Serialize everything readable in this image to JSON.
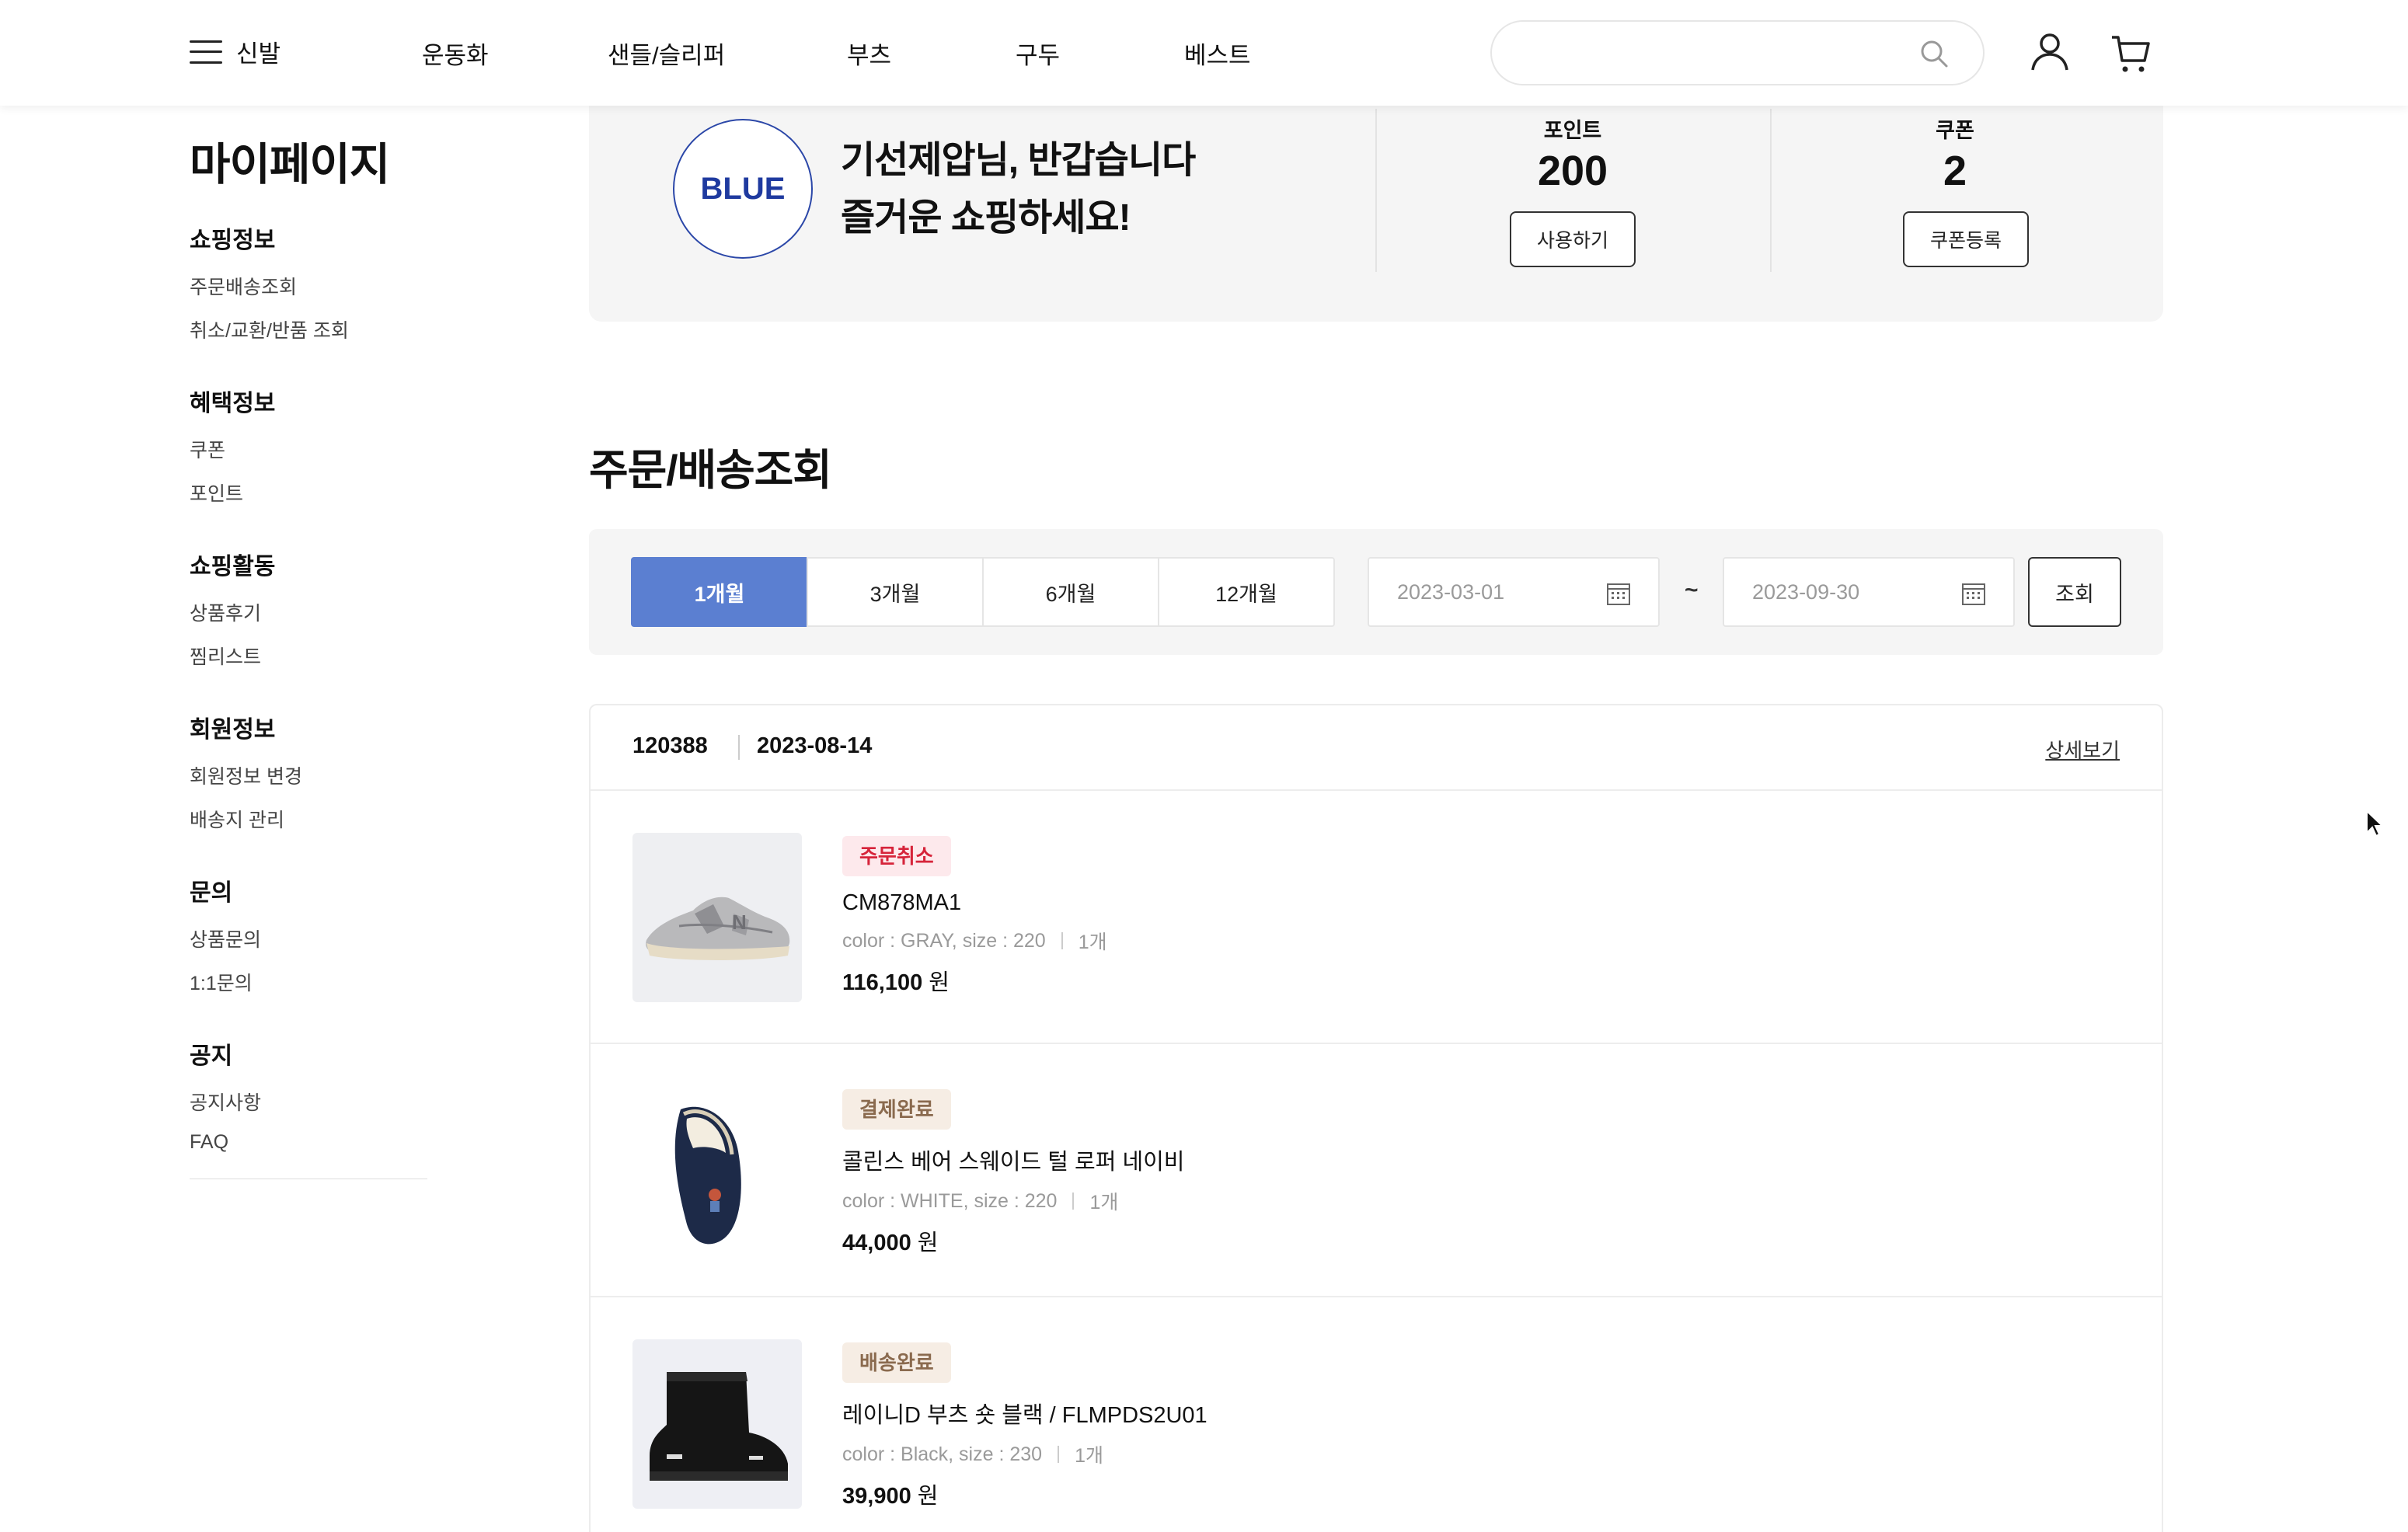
{
  "header": {
    "menu_label": "신발",
    "nav": [
      "운동화",
      "샌들/슬리퍼",
      "부츠",
      "구두",
      "베스트"
    ],
    "search_placeholder": ""
  },
  "sidebar": {
    "title": "마이페이지",
    "groups": [
      {
        "title": "쇼핑정보",
        "items": [
          "주문배송조회",
          "취소/교환/반품 조회"
        ]
      },
      {
        "title": "혜택정보",
        "items": [
          "쿠폰",
          "포인트"
        ]
      },
      {
        "title": "쇼핑활동",
        "items": [
          "상품후기",
          "찜리스트"
        ]
      },
      {
        "title": "회원정보",
        "items": [
          "회원정보 변경",
          "배송지 관리"
        ]
      },
      {
        "title": "문의",
        "items": [
          "상품문의",
          "1:1문의"
        ]
      },
      {
        "title": "공지",
        "items": [
          "공지사항",
          "FAQ"
        ]
      }
    ]
  },
  "profile": {
    "grade": "BLUE",
    "greeting_line1": "기선제압님, 반갑습니다",
    "greeting_line2": "즐거운 쇼핑하세요!",
    "points_label": "포인트",
    "points_value": "200",
    "points_button": "사용하기",
    "coupon_label": "쿠폰",
    "coupon_value": "2",
    "coupon_button": "쿠폰등록"
  },
  "orders_section": {
    "title": "주문/배송조회",
    "periods": [
      "1개월",
      "3개월",
      "6개월",
      "12개월"
    ],
    "active_period": "1개월",
    "date_from": "2023-03-01",
    "date_separator": "~",
    "date_to": "2023-09-30",
    "search_button": "조회"
  },
  "order": {
    "number": "120388",
    "date": "2023-08-14",
    "detail_link": "상세보기",
    "items": [
      {
        "status": "주문취소",
        "status_color": "#d6243a",
        "status_bg": "#fde9ec",
        "name": "CM878MA1",
        "options": "color : GRAY, size : 220",
        "qty": "1개",
        "price": "116,100",
        "currency": "원",
        "image": "grey-sneaker"
      },
      {
        "status": "결제완료",
        "status_color": "#8a6a4e",
        "status_bg": "#f6ede4",
        "name": "콜린스 베어 스웨이드 털 로퍼 네이비",
        "options": "color : WHITE, size : 220",
        "qty": "1개",
        "price": "44,000",
        "currency": "원",
        "image": "navy-loafer"
      },
      {
        "status": "배송완료",
        "status_color": "#8a6a4e",
        "status_bg": "#f6ede4",
        "name": "레이니D 부츠 숏 블랙 / FLMPDS2U01",
        "options": "color : Black, size : 230",
        "qty": "1개",
        "price": "39,900",
        "currency": "원",
        "image": "black-rain-boot"
      }
    ]
  },
  "icons": {
    "search": "search-icon",
    "user": "user-icon",
    "cart": "cart-icon",
    "calendar": "calendar-icon",
    "menu": "hamburger-icon"
  },
  "colors": {
    "accent": "#5b7fd1",
    "grade_blue": "#1f3a9f",
    "panel_bg": "#f5f5f5"
  }
}
